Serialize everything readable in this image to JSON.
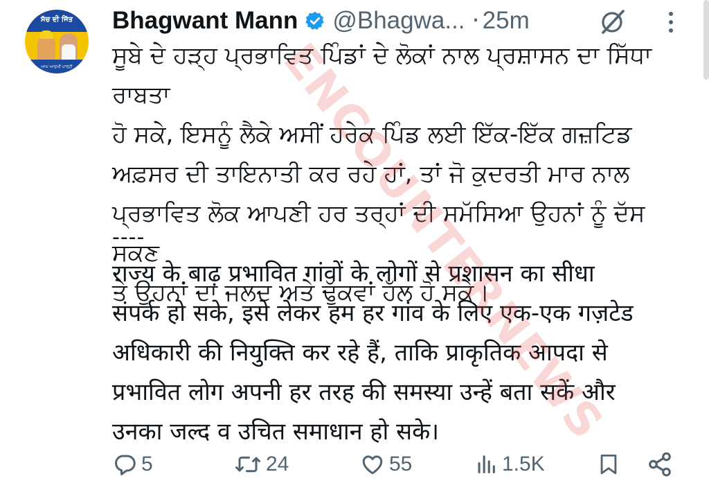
{
  "author": {
    "name": "Bhagwant Mann",
    "handle": "@Bhagwa...",
    "separator": "·",
    "time": "25m",
    "avatar_text_top": "ਸੱਚ ਦੀ ਜਿੱਤ",
    "avatar_text_bottom": "ਆਮ ਆਦਮੀ ਪਾਰਟੀ"
  },
  "icons": {
    "verified": "verified-badge-icon",
    "grok": "grok-icon",
    "more": "more-vertical-icon",
    "reply": "reply-icon",
    "repost": "repost-icon",
    "like": "like-icon",
    "views": "views-icon",
    "bookmark": "bookmark-icon",
    "share": "share-icon"
  },
  "colors": {
    "verified": "#1d9bf0",
    "secondary_text": "#536471",
    "watermark": "#e84a4a"
  },
  "tweet": {
    "punjabi_lines": [
      "ਸੂਬੇ ਦੇ ਹੜ੍ਹ ਪ੍ਰਭਾਵਿਤ ਪਿੰਡਾਂ ਦੇ ਲੋਕਾਂ ਨਾਲ ਪ੍ਰਸ਼ਾਸਨ ਦਾ ਸਿੱਧਾ ਰਾਬਤਾ",
      "ਹੋ ਸਕੇ, ਇਸਨੂੰ ਲੈਕੇ ਅਸੀਂ ਹਰੇਕ ਪਿੰਡ ਲਈ ਇੱਕ-ਇੱਕ ਗਜ਼ਟਿਡ",
      "ਅਫ਼ਸਰ ਦੀ ਤਾਇਨਾਤੀ ਕਰ ਰਹੇ ਹਾਂ, ਤਾਂ ਜੋ ਕੁਦਰਤੀ ਮਾਰ ਨਾਲ",
      "ਪ੍ਰਭਾਵਿਤ ਲੋਕ ਆਪਣੀ ਹਰ ਤਰ੍ਹਾਂ ਦੀ ਸਮੱਸਿਆ ਉਹਨਾਂ ਨੂੰ ਦੱਸ ਸਕਣ",
      "ਤੇ ਉਹਨਾਂ ਦਾ ਜਲਦ ਅਤੇ ਢੁੱਕਵਾਂ ਹੱਲ ਹੋ ਸਕੇ।"
    ],
    "separator": "----",
    "hindi_lines": [
      "राज्य के बाढ़ प्रभावित गांवों के लोगों से प्रशासन का सीधा",
      "संपर्क हो सके, इसे लेकर हम हर गांव के लिए एक-एक गज़टेड",
      "अधिकारी की नियुक्ति कर रहे हैं, ताकि प्राकृतिक आपदा से",
      "प्रभावित लोग अपनी हर तरह की समस्या उन्हें बता सकें और",
      "उनका जल्द व उचित समाधान हो सके।"
    ]
  },
  "watermark": "ENCOUNTERNEWS",
  "actions": {
    "replies": "5",
    "reposts": "24",
    "likes": "55",
    "views": "1.5K"
  }
}
